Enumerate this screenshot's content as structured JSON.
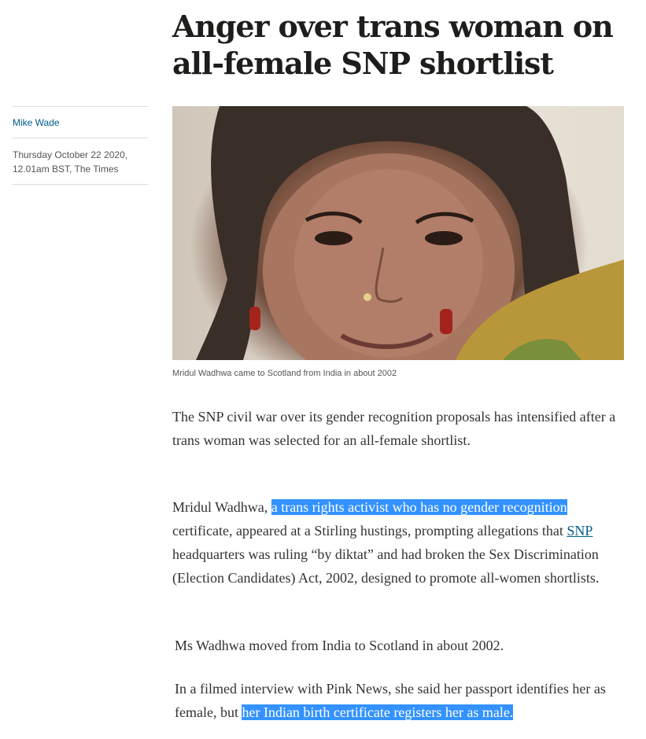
{
  "article": {
    "headline": "Anger over trans woman on all-female SNP shortlist",
    "author": "Mike Wade",
    "date_line1": "Thursday October 22 2020,",
    "date_line2": "12.01am BST, The Times",
    "image": {
      "caption": "Mridul Wadhwa came to Scotland from India in about 2002"
    },
    "paragraphs": {
      "p1": "The SNP civil war over its gender recognition proposals has intensified after a trans woman was selected for an all-female shortlist.",
      "p2_start": "Mridul Wadhwa, ",
      "p2_highlight": "a trans rights activist who has no gender recognition",
      "p2_mid": " certificate, appeared at a Stirling hustings, prompting allegations that ",
      "p2_link": "SNP ",
      "p2_end": "headquarters was ruling “by diktat” and had broken the Sex Discrimination (Election Candidates) Act, 2002, designed to promote all-women shortlists.",
      "p3": "Ms Wadhwa moved from India to Scotland in about 2002.",
      "p4_start": "In a filmed interview with Pink News, she said her passport identifies her as female, but ",
      "p4_highlight": "her Indian birth certificate registers her as male."
    }
  },
  "colors": {
    "highlight": "#3392ff",
    "link": "#005c8a",
    "text": "#333333"
  }
}
